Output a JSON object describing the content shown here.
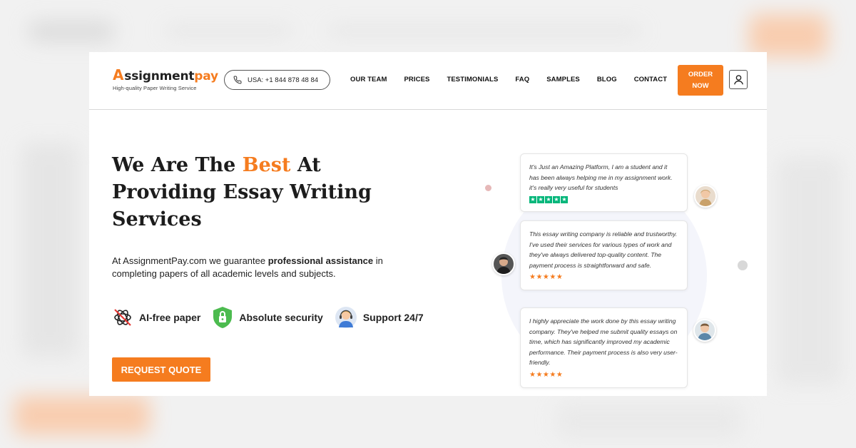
{
  "logo": {
    "mark_a": "A",
    "mark_text": "ssignment",
    "mark_pay": "pay",
    "tagline": "High-quality Paper Writing Service"
  },
  "phone": {
    "icon": "phone-icon",
    "text": "USA: +1 844 878 48 84"
  },
  "nav": [
    {
      "label": "OUR TEAM"
    },
    {
      "label": "PRICES"
    },
    {
      "label": "TESTIMONIALS"
    },
    {
      "label": "FAQ"
    },
    {
      "label": "SAMPLES"
    },
    {
      "label": "BLOG"
    },
    {
      "label": "CONTACT"
    }
  ],
  "order_button": {
    "line1": "ORDER",
    "line2": "NOW"
  },
  "user_icon": "user-icon",
  "hero": {
    "title_part1": "We Are The ",
    "title_accent": "Best",
    "title_part2": " At Providing Essay Writing Services",
    "desc_part1": "At AssignmentPay.com we guarantee ",
    "desc_bold": "professional assistance",
    "desc_part2": " in completing papers of all academic levels and subjects."
  },
  "features": [
    {
      "icon": "no-ai-icon",
      "label": "AI-free paper"
    },
    {
      "icon": "shield-lock-icon",
      "label": "Absolute security"
    },
    {
      "icon": "support-agent-icon",
      "label": "Support 24/7"
    }
  ],
  "quote_button": "REQUEST QUOTE",
  "testimonials": [
    {
      "text": "It's Just an Amazing Platform, I am a student and it has been always helping me in my assignment work. it's really very useful for students",
      "stars": 5,
      "star_style": "green"
    },
    {
      "text": "This essay writing company is reliable and trustworthy. I've used their services for various types of work and they've always delivered top-quality content. The payment process is straightforward and safe.",
      "stars": 5,
      "star_style": "orange"
    },
    {
      "text": "I highly appreciate the work done by this essay writing company. They've helped me submit quality essays on time, which has significantly improved my academic performance. Their payment process is also very user-friendly.",
      "stars": 5,
      "star_style": "orange"
    }
  ],
  "colors": {
    "accent": "#f57c1f",
    "trustpilot": "#00b67a",
    "text": "#1c1c1c"
  }
}
